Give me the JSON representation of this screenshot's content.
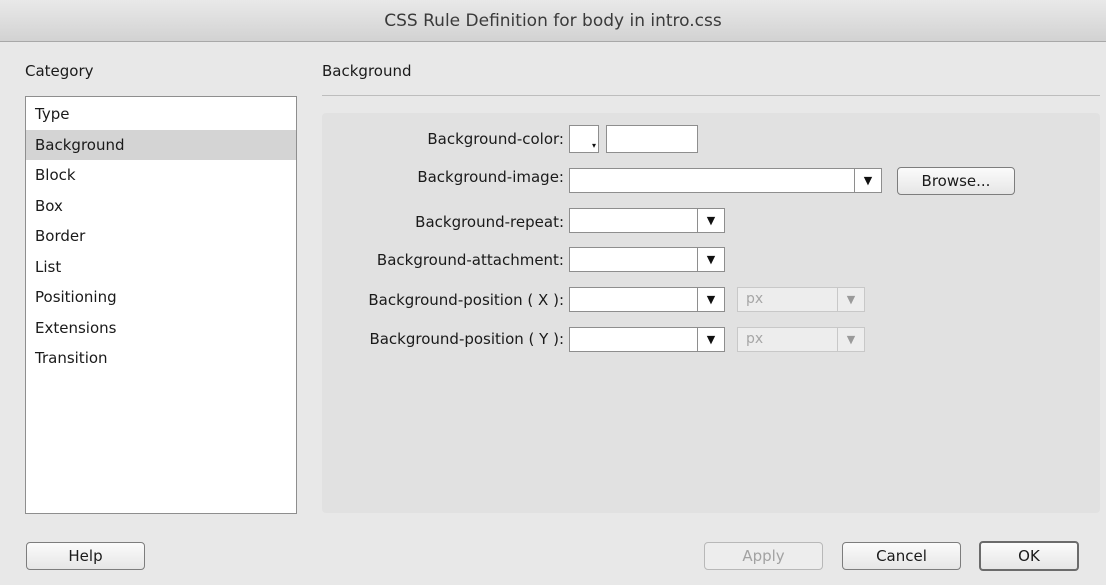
{
  "window": {
    "title": "CSS Rule Definition for body in intro.css"
  },
  "category": {
    "heading": "Category",
    "items": [
      "Type",
      "Background",
      "Block",
      "Box",
      "Border",
      "List",
      "Positioning",
      "Extensions",
      "Transition"
    ],
    "selected": "Background"
  },
  "section": {
    "title": "Background"
  },
  "fields": {
    "bg_color": {
      "label": "Background-color:",
      "value": ""
    },
    "bg_image": {
      "label": "Background-image:",
      "value": "",
      "browse_label": "Browse..."
    },
    "bg_repeat": {
      "label": "Background-repeat:",
      "value": ""
    },
    "bg_attachment": {
      "label": "Background-attachment:",
      "value": ""
    },
    "bg_pos_x": {
      "label": "Background-position ( X ):",
      "value": "",
      "unit": "px"
    },
    "bg_pos_y": {
      "label": "Background-position ( Y ):",
      "value": "",
      "unit": "px"
    }
  },
  "buttons": {
    "help": "Help",
    "apply": "Apply",
    "cancel": "Cancel",
    "ok": "OK"
  },
  "icons": {
    "dropdown": "▼",
    "swatch_arrow": "▾"
  },
  "colors": {
    "selected_row": "#d4d4d4",
    "panel": "#e1e1e1",
    "dialog": "#e8e8e8"
  }
}
